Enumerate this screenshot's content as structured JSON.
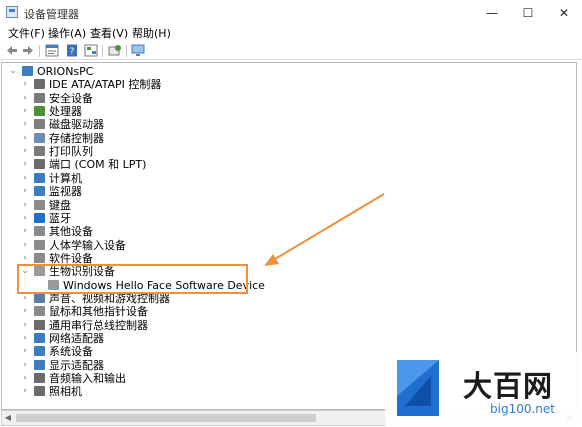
{
  "window": {
    "title": "设备管理器",
    "controls": [
      "—",
      "☐",
      "✕"
    ]
  },
  "menu": [
    "文件(F)",
    "操作(A)",
    "查看(V)",
    "帮助(H)"
  ],
  "toolbar_icons": [
    "back-arrow-icon",
    "forward-arrow-icon",
    "properties-icon",
    "help-icon",
    "show-hidden-icon",
    "scan-icon",
    "monitor-icon"
  ],
  "tree": {
    "root": "ORIONsPC",
    "categories": [
      {
        "label": "IDE ATA/ATAPI 控制器",
        "icon": "ide-controller-icon",
        "color": "#6b6b6b"
      },
      {
        "label": "安全设备",
        "icon": "security-device-icon",
        "color": "#7a7a7a"
      },
      {
        "label": "处理器",
        "icon": "processor-icon",
        "color": "#4f8f3a"
      },
      {
        "label": "磁盘驱动器",
        "icon": "disk-drive-icon",
        "color": "#808080"
      },
      {
        "label": "存储控制器",
        "icon": "storage-controller-icon",
        "color": "#6a8fb6"
      },
      {
        "label": "打印队列",
        "icon": "printer-icon",
        "color": "#7a7a7a"
      },
      {
        "label": "端口 (COM 和 LPT)",
        "icon": "port-icon",
        "color": "#6b6b6b"
      },
      {
        "label": "计算机",
        "icon": "computer-icon",
        "color": "#3e7cc0"
      },
      {
        "label": "监视器",
        "icon": "monitor-icon",
        "color": "#3e7cc0"
      },
      {
        "label": "键盘",
        "icon": "keyboard-icon",
        "color": "#8a8a8a"
      },
      {
        "label": "蓝牙",
        "icon": "bluetooth-icon",
        "color": "#1e6fd0"
      },
      {
        "label": "其他设备",
        "icon": "other-device-icon",
        "color": "#8a8a8a"
      },
      {
        "label": "人体学输入设备",
        "icon": "hid-icon",
        "color": "#8a8a8a"
      },
      {
        "label": "软件设备",
        "icon": "software-device-icon",
        "color": "#8a8a8a"
      },
      {
        "label": "生物识别设备",
        "icon": "biometric-icon",
        "color": "#9a9a9a",
        "expanded": true,
        "children": [
          {
            "label": "Windows Hello Face Software Device",
            "icon": "biometric-device-icon",
            "color": "#9a9a9a"
          }
        ]
      },
      {
        "label": "声音、视频和游戏控制器",
        "icon": "sound-icon",
        "color": "#5a7fa6"
      },
      {
        "label": "鼠标和其他指针设备",
        "icon": "mouse-icon",
        "color": "#8a8a8a"
      },
      {
        "label": "通用串行总线控制器",
        "icon": "usb-icon",
        "color": "#6b6b6b"
      },
      {
        "label": "网络适配器",
        "icon": "network-adapter-icon",
        "color": "#3e7cc0"
      },
      {
        "label": "系统设备",
        "icon": "system-device-icon",
        "color": "#3e7cc0"
      },
      {
        "label": "显示适配器",
        "icon": "display-adapter-icon",
        "color": "#3e7cc0"
      },
      {
        "label": "音频输入和输出",
        "icon": "audio-io-icon",
        "color": "#6b6b6b"
      },
      {
        "label": "照相机",
        "icon": "camera-icon",
        "color": "#6b6b6b"
      }
    ]
  },
  "annotation": {
    "color": "#f0913a"
  },
  "watermark": {
    "main": "大百网",
    "sub": "big100.net",
    "accent": "#2e7dd6"
  }
}
